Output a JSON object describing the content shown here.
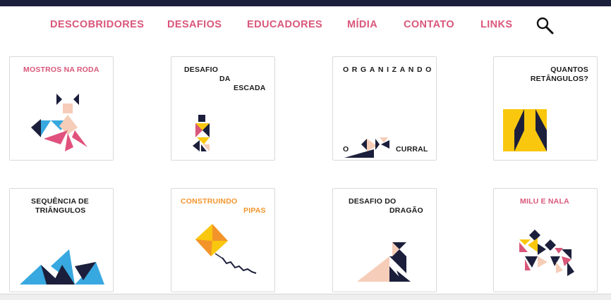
{
  "nav": {
    "items": [
      "DESCOBRIDORES",
      "DESAFIOS",
      "EDUCADORES",
      "MÍDIA",
      "CONTATO",
      "LINKS"
    ],
    "search_icon": "search-icon"
  },
  "cards": [
    {
      "title": "MOSTROS NA RODA"
    },
    {
      "title_lines": [
        "DESAFIO",
        "DA",
        "ESCADA"
      ]
    },
    {
      "title": "ORGANIZANDO",
      "title_bottom_left": "O",
      "title_bottom_right": "CURRAL"
    },
    {
      "title_lines": [
        "QUANTOS",
        "RETÂNGULOS?"
      ]
    },
    {
      "title_lines": [
        "SEQUÊNCIA DE",
        "TRIÂNGULOS"
      ]
    },
    {
      "title_lines": [
        "CONSTRUINDO",
        "PIPAS"
      ]
    },
    {
      "title_lines": [
        "DESAFIO DO",
        "DRAGÃO"
      ]
    },
    {
      "title": "MILU E NALA"
    }
  ],
  "colors": {
    "accent_pink": "#d9577a",
    "accent_orange": "#f2942a",
    "navy": "#1c1f3b",
    "yellow": "#f9c80e",
    "peach": "#f6cdb8",
    "blue": "#38a8e0"
  }
}
